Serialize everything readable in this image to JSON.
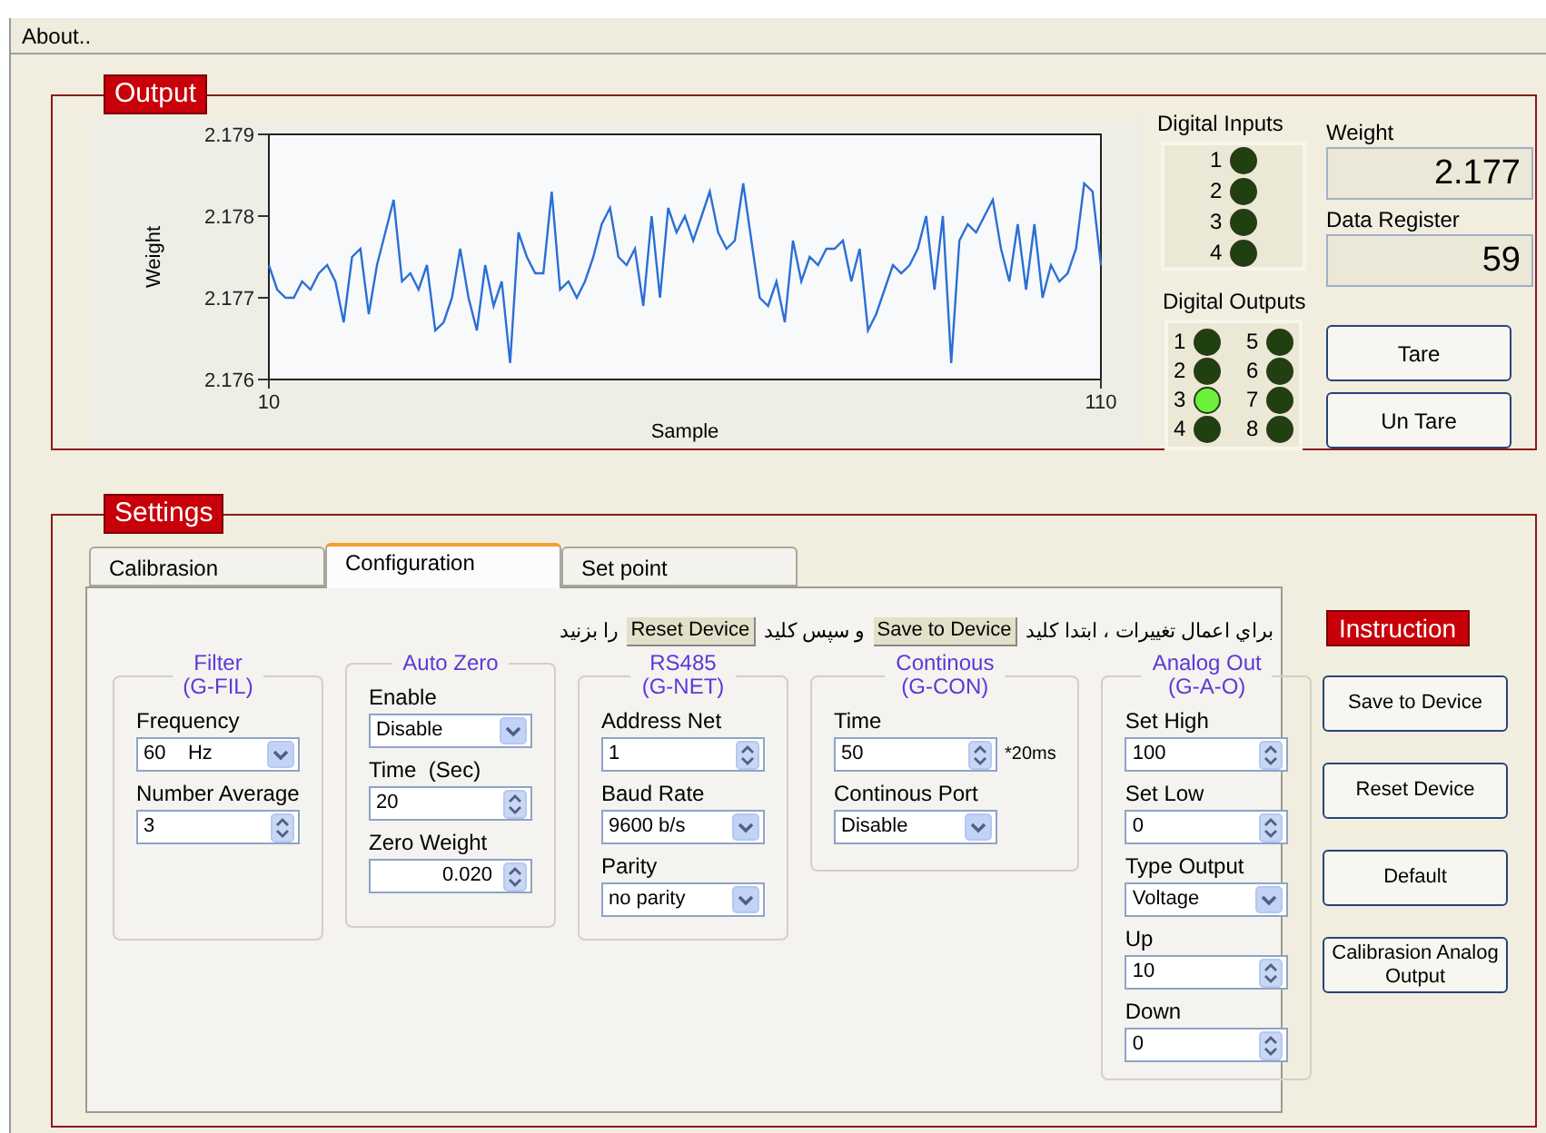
{
  "menu": [
    {
      "label": "About.."
    }
  ],
  "output": {
    "title": "Output",
    "chart": {
      "chart_data": {
        "type": "line",
        "xlabel": "Sample",
        "ylabel": "Weight",
        "xlim": [
          10,
          110
        ],
        "ylim": [
          2.176,
          2.179
        ],
        "xticks": [
          10,
          110
        ],
        "yticks": [
          {
            "value": 2.176,
            "label": "2.176"
          },
          {
            "value": 2.177,
            "label": "2.177"
          },
          {
            "value": 2.178,
            "label": "2.178"
          },
          {
            "value": 2.179,
            "label": "2.179"
          }
        ],
        "x": [
          10,
          11,
          12,
          13,
          14,
          15,
          16,
          17,
          18,
          19,
          20,
          21,
          22,
          23,
          24,
          25,
          26,
          27,
          28,
          29,
          30,
          31,
          32,
          33,
          34,
          35,
          36,
          37,
          38,
          39,
          40,
          41,
          42,
          43,
          44,
          45,
          46,
          47,
          48,
          49,
          50,
          51,
          52,
          53,
          54,
          55,
          56,
          57,
          58,
          59,
          60,
          61,
          62,
          63,
          64,
          65,
          66,
          67,
          68,
          69,
          70,
          71,
          72,
          73,
          74,
          75,
          76,
          77,
          78,
          79,
          80,
          81,
          82,
          83,
          84,
          85,
          86,
          87,
          88,
          89,
          90,
          91,
          92,
          93,
          94,
          95,
          96,
          97,
          98,
          99,
          100,
          101,
          102,
          103,
          104,
          105,
          106,
          107,
          108,
          109,
          110
        ],
        "series": [
          {
            "color": "#2a6fd6",
            "values": [
              2.1774,
              2.1771,
              2.177,
              2.177,
              2.1772,
              2.1771,
              2.1773,
              2.1774,
              2.1772,
              2.1767,
              2.1775,
              2.1776,
              2.1768,
              2.1774,
              2.1778,
              2.1782,
              2.1772,
              2.1773,
              2.1771,
              2.1774,
              2.1766,
              2.1767,
              2.177,
              2.1776,
              2.177,
              2.1766,
              2.1774,
              2.1769,
              2.1772,
              2.1762,
              2.1778,
              2.1775,
              2.1773,
              2.1773,
              2.1783,
              2.1771,
              2.1772,
              2.177,
              2.1772,
              2.1775,
              2.1779,
              2.1781,
              2.1775,
              2.1774,
              2.1776,
              2.1769,
              2.178,
              2.177,
              2.1781,
              2.1778,
              2.178,
              2.1777,
              2.178,
              2.1783,
              2.1778,
              2.1776,
              2.1777,
              2.1784,
              2.1777,
              2.177,
              2.1769,
              2.1772,
              2.1767,
              2.1777,
              2.1772,
              2.1775,
              2.1774,
              2.1776,
              2.1776,
              2.1777,
              2.1772,
              2.1776,
              2.1766,
              2.1768,
              2.1771,
              2.1774,
              2.1773,
              2.1774,
              2.1776,
              2.178,
              2.1771,
              2.178,
              2.1762,
              2.1777,
              2.1779,
              2.1778,
              2.178,
              2.1782,
              2.1776,
              2.1772,
              2.1779,
              2.1771,
              2.1779,
              2.177,
              2.1774,
              2.1772,
              2.1773,
              2.1776,
              2.1784,
              2.1783,
              2.1774
            ]
          }
        ]
      }
    },
    "digital_inputs": {
      "label": "Digital Inputs",
      "items": [
        {
          "label": "1",
          "on": false
        },
        {
          "label": "2",
          "on": false
        },
        {
          "label": "3",
          "on": false
        },
        {
          "label": "4",
          "on": false
        }
      ]
    },
    "digital_outputs": {
      "label": "Digital Outputs",
      "items": [
        {
          "label": "1",
          "on": false
        },
        {
          "label": "2",
          "on": false
        },
        {
          "label": "3",
          "on": true
        },
        {
          "label": "4",
          "on": false
        },
        {
          "label": "5",
          "on": false
        },
        {
          "label": "6",
          "on": false
        },
        {
          "label": "7",
          "on": false
        },
        {
          "label": "8",
          "on": false
        }
      ]
    },
    "weight": {
      "label": "Weight",
      "value": "2.177"
    },
    "data_register": {
      "label": "Data Register",
      "value": "59"
    },
    "buttons": [
      "Tare",
      "Un Tare"
    ]
  },
  "settings": {
    "title": "Settings",
    "tabs": [
      {
        "label": "Calibrasion",
        "selected": false
      },
      {
        "label": "Configuration",
        "selected": true
      },
      {
        "label": "Set point",
        "selected": false
      }
    ],
    "instruction_line": [
      {
        "kind": "text",
        "text": "براي اعمال تغييرات ، ابتدا كليد"
      },
      {
        "kind": "key",
        "text": "Save to Device"
      },
      {
        "kind": "text",
        "text": "و سپس كليد"
      },
      {
        "kind": "key",
        "text": "Reset Device"
      },
      {
        "kind": "text",
        "text": "را بزنيد"
      }
    ],
    "groups": [
      {
        "title": [
          "Filter",
          "(G-FIL)"
        ],
        "fields": [
          {
            "label": "Frequency",
            "kind": "dropdown",
            "value": "60    Hz"
          },
          {
            "label": "Number Average",
            "kind": "spin",
            "value": "3"
          }
        ]
      },
      {
        "title": [
          "Auto Zero"
        ],
        "fields": [
          {
            "label": "Enable",
            "kind": "dropdown",
            "value": "Disable"
          },
          {
            "label": "Time  (Sec)",
            "kind": "spin",
            "value": "20"
          },
          {
            "label": "Zero Weight",
            "kind": "spin_right",
            "value": "0.020"
          }
        ]
      },
      {
        "title": [
          "RS485",
          "(G-NET)"
        ],
        "fields": [
          {
            "label": "Address Net",
            "kind": "spin",
            "value": "1"
          },
          {
            "label": "Baud Rate",
            "kind": "dropdown",
            "value": "9600 b/s"
          },
          {
            "label": "Parity",
            "kind": "dropdown",
            "value": "no parity"
          }
        ]
      },
      {
        "title": [
          "Continous",
          "(G-CON)"
        ],
        "fields": [
          {
            "label": "Time",
            "kind": "spin",
            "value": "50",
            "unit": "*20ms"
          },
          {
            "label": "Continous Port",
            "kind": "dropdown",
            "value": "Disable"
          }
        ]
      },
      {
        "title": [
          "Analog Out",
          "(G-A-O)"
        ],
        "fields": [
          {
            "label": "Set High",
            "kind": "spin",
            "value": "100"
          },
          {
            "label": "Set Low",
            "kind": "spin",
            "value": "0"
          },
          {
            "label": "Type Output",
            "kind": "dropdown",
            "value": "Voltage"
          },
          {
            "label": "Up",
            "kind": "spin",
            "value": "10"
          },
          {
            "label": "Down",
            "kind": "spin",
            "value": "0"
          }
        ]
      }
    ],
    "instruction": {
      "title": "Instruction",
      "buttons": [
        "Save to Device",
        "Reset Device",
        "Default",
        "Calibrasion Analog Output"
      ]
    }
  }
}
